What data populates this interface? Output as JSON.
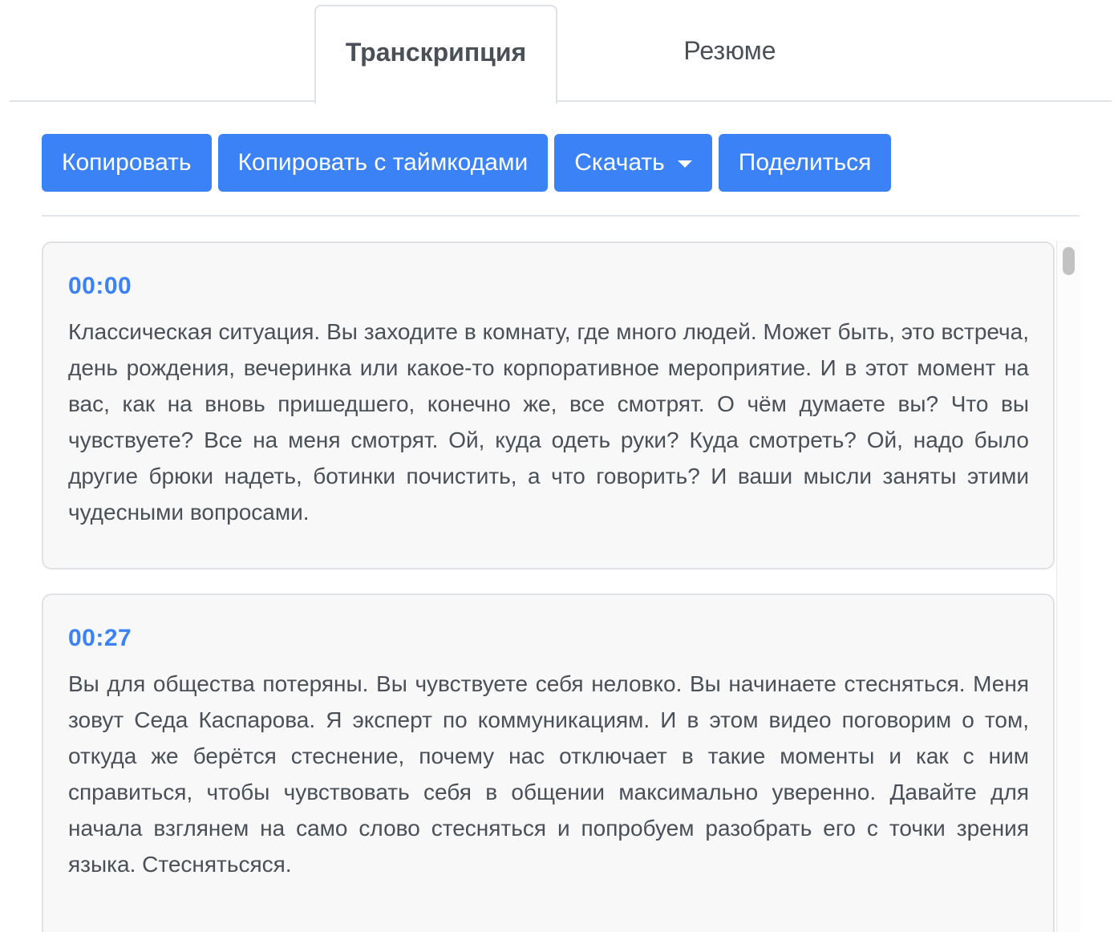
{
  "tabs": [
    {
      "label": "Транскрипция",
      "active": true
    },
    {
      "label": "Резюме",
      "active": false
    }
  ],
  "toolbar": {
    "copy_label": "Копировать",
    "copy_timecodes_label": "Копировать с таймкодами",
    "download_label": "Скачать",
    "share_label": "Поделиться"
  },
  "segments": [
    {
      "time": "00:00",
      "text": "Классическая ситуация. Вы заходите в комнату, где много людей. Может быть, это встреча, день рождения, вечеринка или какое-то корпоративное мероприятие. И в этот момент на вас, как на вновь пришедшего, конечно же, все смотрят. О чём думаете вы? Что вы чувствуете? Все на меня смотрят. Ой, куда одеть руки? Куда смотреть? Ой, надо было другие брюки надеть, ботинки почистить, а что говорить? И ваши мысли заняты этими чудесными вопросами."
    },
    {
      "time": "00:27",
      "text": "Вы для общества потеряны. Вы чувствуете себя неловко. Вы начинаете стесняться. Меня зовут Седа Каспарова. Я эксперт по коммуникациям. И в этом видео поговорим о том, откуда же берётся стеснение, почему нас отключает в такие моменты и как с ним справиться, чтобы чувствовать себя в общении максимально уверенно. Давайте для начала взглянем на само слово стесняться и попробуем разобрать его с точки зрения языка. Стеснятьсяся."
    }
  ],
  "colors": {
    "accent": "#3b82f6",
    "text": "#495057",
    "border": "#dee2e6",
    "card_bg": "#f8f8f8"
  }
}
